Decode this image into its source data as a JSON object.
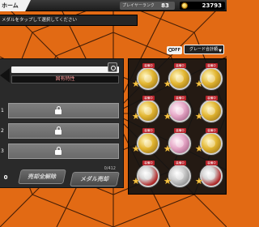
{
  "header": {
    "home_label": "ホーム",
    "rank_label": "プレイヤーランク",
    "rank_value": "83",
    "coin_value": "23793"
  },
  "instruction": "メダルをタップして選択してください",
  "controls": {
    "off_label": "OFF",
    "sort_label": "グレード合計順"
  },
  "panel": {
    "trait_header": "固有特性",
    "slots": [
      {
        "num": "1",
        "locked": true
      },
      {
        "num": "2",
        "locked": true
      },
      {
        "num": "3",
        "locked": true
      }
    ]
  },
  "footer": {
    "selected_count": "0",
    "sell_all_label": "売却全解除",
    "medal_count": "0/412",
    "medal_sell_label": "メダル売却"
  },
  "grid": {
    "medals": [
      {
        "tag": "装備中",
        "kind": "gold"
      },
      {
        "tag": "装備中",
        "kind": "gold"
      },
      {
        "tag": "装備中",
        "kind": "gold"
      },
      {
        "tag": "装備中",
        "kind": "gold"
      },
      {
        "tag": "装備中",
        "kind": "pink"
      },
      {
        "tag": "装備中",
        "kind": "gold"
      },
      {
        "tag": "装備中",
        "kind": "gold"
      },
      {
        "tag": "装備中",
        "kind": "pink"
      },
      {
        "tag": "装備中",
        "kind": "gold"
      },
      {
        "tag": "装備中",
        "kind": "redsilver"
      },
      {
        "tag": "装備中",
        "kind": "silver"
      },
      {
        "tag": "装備中",
        "kind": "redsilver"
      }
    ],
    "star_symbol": "★"
  }
}
